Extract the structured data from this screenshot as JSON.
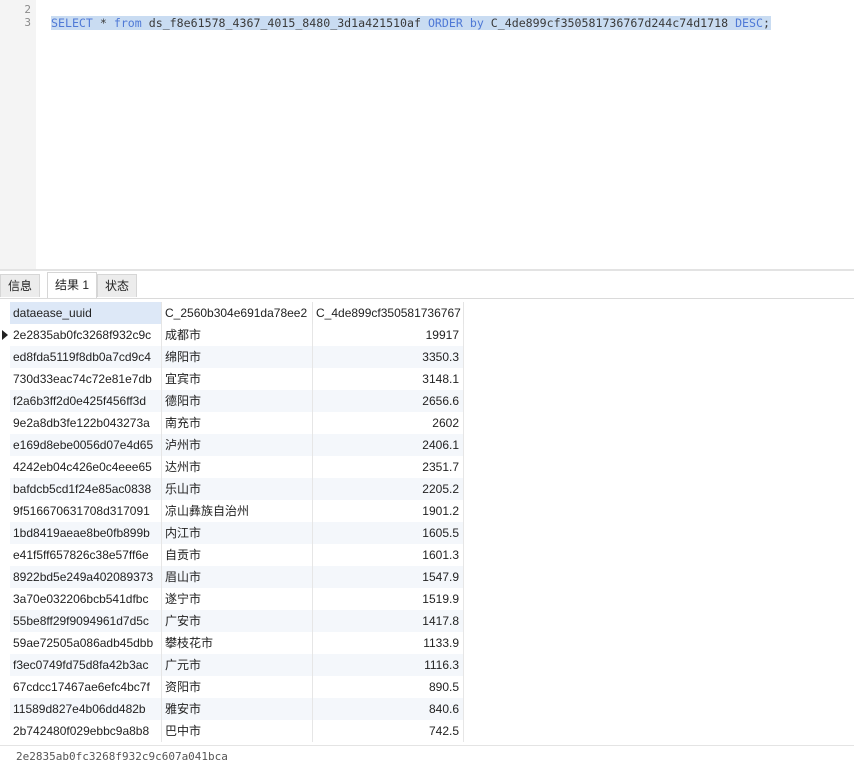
{
  "editor": {
    "lines": [
      {
        "number": "2",
        "text": ""
      },
      {
        "number": "3",
        "tokens": [
          {
            "t": "SELECT",
            "kw": true
          },
          {
            "t": " * ",
            "kw": false
          },
          {
            "t": "from",
            "kw": true
          },
          {
            "t": " ds_f8e61578_4367_4015_8480_3d1a421510af ",
            "kw": false
          },
          {
            "t": "ORDER by",
            "kw": true
          },
          {
            "t": " C_4de899cf350581736767d244c74d1718 ",
            "kw": false
          },
          {
            "t": "DESC",
            "kw": true
          },
          {
            "t": ";",
            "kw": false
          }
        ]
      }
    ]
  },
  "tabs": [
    {
      "label": "信息",
      "active": false
    },
    {
      "label": "结果 1",
      "active": true
    },
    {
      "label": "状态",
      "active": false
    }
  ],
  "grid": {
    "columns": [
      "dataease_uuid",
      "C_2560b304e691da78ee2",
      "C_4de899cf350581736767"
    ],
    "rows": [
      [
        "2e2835ab0fc3268f932c9c",
        "成都市",
        "19917"
      ],
      [
        "ed8fda5119f8db0a7cd9c4",
        "绵阳市",
        "3350.3"
      ],
      [
        "730d33eac74c72e81e7db",
        "宜宾市",
        "3148.1"
      ],
      [
        "f2a6b3ff2d0e425f456ff3d",
        "德阳市",
        "2656.6"
      ],
      [
        "9e2a8db3fe122b043273a",
        "南充市",
        "2602"
      ],
      [
        "e169d8ebe0056d07e4d65",
        "泸州市",
        "2406.1"
      ],
      [
        "4242eb04c426e0c4eee65",
        "达州市",
        "2351.7"
      ],
      [
        "bafdcb5cd1f24e85ac0838",
        "乐山市",
        "2205.2"
      ],
      [
        "9f516670631708d317091",
        "凉山彝族自治州",
        "1901.2"
      ],
      [
        "1bd8419aeae8be0fb899b",
        "内江市",
        "1605.5"
      ],
      [
        "e41f5ff657826c38e57ff6e",
        "自贡市",
        "1601.3"
      ],
      [
        "8922bd5e249a402089373",
        "眉山市",
        "1547.9"
      ],
      [
        "3a70e032206bcb541dfbc",
        "遂宁市",
        "1519.9"
      ],
      [
        "55be8ff29f9094961d7d5c",
        "广安市",
        "1417.8"
      ],
      [
        "59ae72505a086adb45dbb",
        "攀枝花市",
        "1133.9"
      ],
      [
        "f3ec0749fd75d8fa42b3ac",
        "广元市",
        "1116.3"
      ],
      [
        "67cdcc17467ae6efc4bc7f",
        "资阳市",
        "890.5"
      ],
      [
        "11589d827e4b06dd482b",
        "雅安市",
        "840.6"
      ],
      [
        "2b742480f029ebbc9a8b8",
        "巴中市",
        "742.5"
      ]
    ]
  },
  "status": {
    "text": "2e2835ab0fc3268f932c9c607a041bca"
  }
}
